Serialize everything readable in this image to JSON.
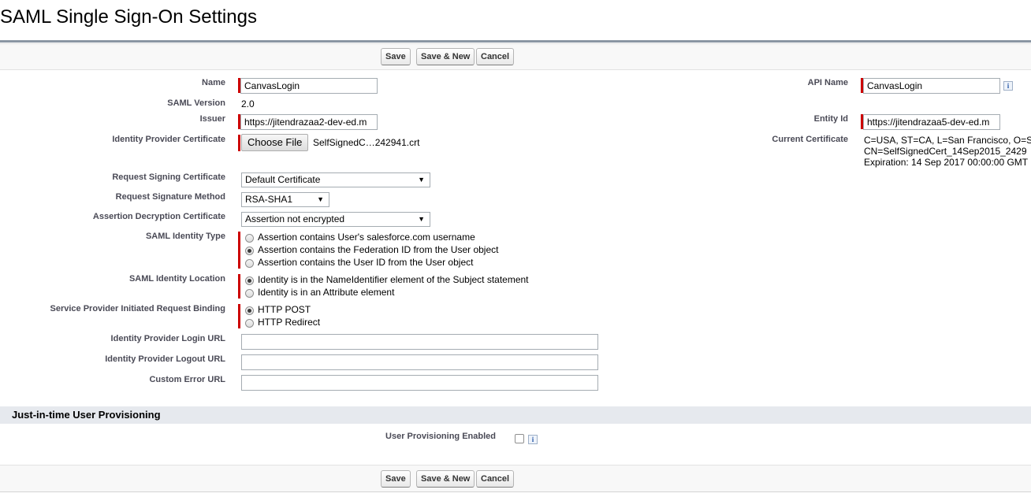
{
  "page": {
    "title": "SAML Single Sign-On Settings"
  },
  "toolbar": {
    "save": "Save",
    "save_new": "Save & New",
    "cancel": "Cancel"
  },
  "form": {
    "name": {
      "label": "Name",
      "value": "CanvasLogin"
    },
    "api_name": {
      "label": "API Name",
      "value": "CanvasLogin",
      "info_icon": "i"
    },
    "saml_version": {
      "label": "SAML Version",
      "value": "2.0"
    },
    "issuer": {
      "label": "Issuer",
      "value": "https://jitendrazaa2-dev-ed.m"
    },
    "entity_id": {
      "label": "Entity Id",
      "value": "https://jitendrazaa5-dev-ed.m"
    },
    "idp_certificate": {
      "label": "Identity Provider Certificate",
      "button": "Choose File",
      "file": "SelfSignedC…242941.crt"
    },
    "current_certificate": {
      "label": "Current Certificate",
      "line1": "C=USA, ST=CA, L=San Francisco, O=S",
      "line2": "CN=SelfSignedCert_14Sep2015_2429",
      "line3": "Expiration: 14 Sep 2017 00:00:00 GMT"
    },
    "request_signing_cert": {
      "label": "Request Signing Certificate",
      "value": "Default Certificate"
    },
    "request_signature_method": {
      "label": "Request Signature Method",
      "value": "RSA-SHA1"
    },
    "assertion_decryption_cert": {
      "label": "Assertion Decryption Certificate",
      "value": "Assertion not encrypted"
    },
    "saml_identity_type": {
      "label": "SAML Identity Type",
      "options": [
        {
          "label": "Assertion contains User's salesforce.com username",
          "selected": false
        },
        {
          "label": "Assertion contains the Federation ID from the User object",
          "selected": true
        },
        {
          "label": "Assertion contains the User ID from the User object",
          "selected": false
        }
      ]
    },
    "saml_identity_location": {
      "label": "SAML Identity Location",
      "options": [
        {
          "label": "Identity is in the NameIdentifier element of the Subject statement",
          "selected": true
        },
        {
          "label": "Identity is in an Attribute element",
          "selected": false
        }
      ]
    },
    "sp_request_binding": {
      "label": "Service Provider Initiated Request Binding",
      "options": [
        {
          "label": "HTTP POST",
          "selected": true
        },
        {
          "label": "HTTP Redirect",
          "selected": false
        }
      ]
    },
    "idp_login_url": {
      "label": "Identity Provider Login URL",
      "value": ""
    },
    "idp_logout_url": {
      "label": "Identity Provider Logout URL",
      "value": ""
    },
    "custom_error_url": {
      "label": "Custom Error URL",
      "value": ""
    }
  },
  "jit": {
    "title": "Just-in-time User Provisioning",
    "user_provisioning": {
      "label": "User Provisioning Enabled",
      "checked": false,
      "info_icon": "i"
    }
  },
  "icons": {
    "dropdown": "▼",
    "info": "info-icon"
  },
  "colors": {
    "required": "#cc0000",
    "section_bg": "#e6e9ee",
    "rule": "#8a96a3"
  }
}
